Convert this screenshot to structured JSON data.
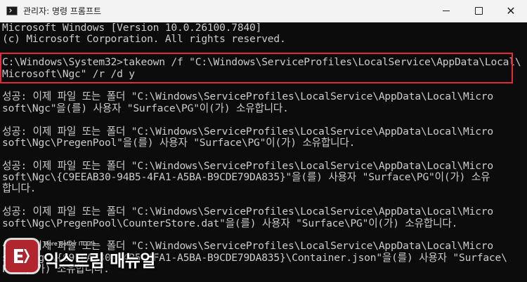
{
  "window": {
    "title": "관리자: 명령 프롬프트",
    "icon": "cmd-icon",
    "controls": {
      "minimize": "minimize-icon",
      "maximize": "maximize-icon",
      "close": "✕"
    }
  },
  "terminal": {
    "lines": [
      "Microsoft Windows [Version 10.0.26100.7840]",
      "(c) Microsoft Corporation. All rights reserved.",
      "",
      "C:\\Windows\\System32>takeown /f \"C:\\Windows\\ServiceProfiles\\LocalService\\AppData\\Local\\",
      "Microsoft\\Ngc\" /r /d y",
      "",
      "성공: 이제 파일 또는 폴더 \"C:\\Windows\\ServiceProfiles\\LocalService\\AppData\\Local\\Micro",
      "soft\\Ngc\"을(를) 사용자 \"Surface\\PG\"이(가) 소유합니다.",
      "",
      "성공: 이제 파일 또는 폴더 \"C:\\Windows\\ServiceProfiles\\LocalService\\AppData\\Local\\Micro",
      "soft\\Ngc\\PregenPool\"을(를) 사용자 \"Surface\\PG\"이(가) 소유합니다.",
      "",
      "성공: 이제 파일 또는 폴더 \"C:\\Windows\\ServiceProfiles\\LocalService\\AppData\\Local\\Micro",
      "soft\\Ngc\\{C9EEAB30-94B5-4FA1-A5BA-B9CDE79DA835}\"을(를) 사용자 \"Surface\\PG\"이(가) 소유",
      "합니다.",
      "",
      "성공: 이제 파일 또는 폴더 \"C:\\Windows\\ServiceProfiles\\LocalService\\AppData\\Local\\Micro",
      "soft\\Ngc\\PregenPool\\CounterStore.dat\"을(를) 사용자 \"Surface\\PG\"이(가) 소유합니다.",
      "",
      "성공: 이제 파일 또는 폴더 \"C:\\Windows\\ServiceProfiles\\LocalService\\AppData\\Local\\Micro",
      "soft\\Ngc\\{C9EEAB30-94B5-4FA1-A5BA-B9CDE79DA835}\\Container.json\"을(를) 사용자 \"Surface\\",
      "PG\"이(가) 소유합니다."
    ]
  },
  "watermark": {
    "tagline": "More Better IT Life",
    "name": "익스트림 매뉴얼",
    "badge_color": "#b1252f"
  },
  "colors": {
    "terminal_bg": "#0c0c0c",
    "terminal_fg": "#cccccc",
    "highlight": "#e5293b",
    "titlebar_bg": "#f3f3f3"
  }
}
